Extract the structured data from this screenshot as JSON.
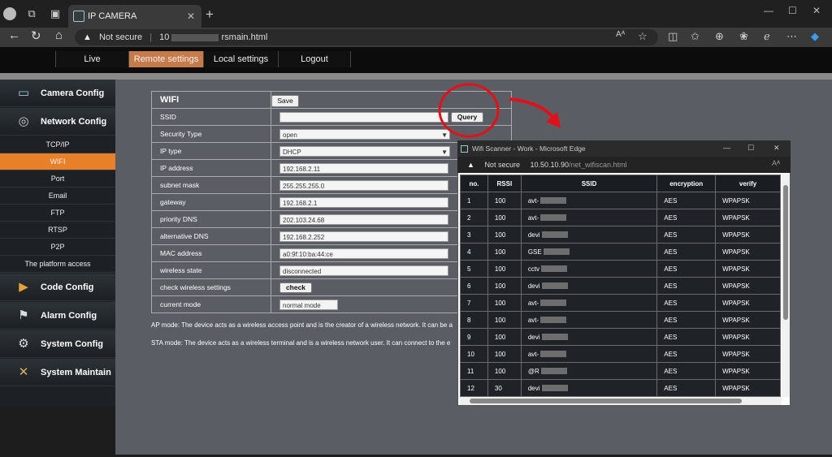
{
  "browser": {
    "tab_title": "IP CAMERA",
    "tab_close": "✕",
    "new_tab": "+",
    "security": "Not secure",
    "url_prefix": "10",
    "url_suffix": "rsmain.html",
    "read_aloud": "Aᴬ"
  },
  "topnav": {
    "tabs": [
      {
        "label": "Live"
      },
      {
        "label": "Remote settings"
      },
      {
        "label": "Local settings"
      },
      {
        "label": "Logout"
      }
    ]
  },
  "sidebar": {
    "groups": {
      "camera": "Camera Config",
      "network": "Network Config",
      "code": "Code Config",
      "alarm": "Alarm Config",
      "system": "System Config",
      "maintain": "System Maintain"
    },
    "items": [
      "TCP/IP",
      "WIFI",
      "Port",
      "Email",
      "FTP",
      "RTSP",
      "P2P",
      "The platform access"
    ]
  },
  "form": {
    "title": "WIFI",
    "save_label": "Save",
    "query_label": "Query",
    "check_label": "check",
    "rows": [
      {
        "label": "SSID",
        "value": ""
      },
      {
        "label": "Security Type",
        "value": "open"
      },
      {
        "label": "IP type",
        "value": "DHCP"
      },
      {
        "label": "IP address",
        "value": "192.168.2.11"
      },
      {
        "label": "subnet mask",
        "value": "255.255.255.0"
      },
      {
        "label": "gateway",
        "value": "192.168.2.1"
      },
      {
        "label": "priority DNS",
        "value": "202.103.24.68"
      },
      {
        "label": "alternative DNS",
        "value": "192.168.2.252"
      },
      {
        "label": "MAC address",
        "value": "a0:9f:10:ba:44:ce"
      },
      {
        "label": "wireless state",
        "value": "disconnected"
      },
      {
        "label": "check wireless settings",
        "value": ""
      },
      {
        "label": "current mode",
        "value": "normal mode"
      }
    ],
    "ap_note": "AP mode: The device acts as a wireless access point and is the creator of a wireless network. It can be a",
    "sta_note": "STA mode: The device acts as a wireless terminal and is a wireless network user. It can connect to the e"
  },
  "scanner": {
    "title": "Wifi Scanner - Work - Microsoft Edge",
    "security": "Not secure",
    "host": "10.50.10.90",
    "path": "/net_wifiscan.html",
    "columns": [
      "no.",
      "RSSI",
      "SSID",
      "encryption",
      "verify"
    ],
    "rows": [
      {
        "no": "1",
        "rssi": "100",
        "ssid": "avt-",
        "enc": "AES",
        "verify": "WPAPSK"
      },
      {
        "no": "2",
        "rssi": "100",
        "ssid": "avt-",
        "enc": "AES",
        "verify": "WPAPSK"
      },
      {
        "no": "3",
        "rssi": "100",
        "ssid": "devi",
        "enc": "AES",
        "verify": "WPAPSK"
      },
      {
        "no": "4",
        "rssi": "100",
        "ssid": "GSE",
        "enc": "AES",
        "verify": "WPAPSK"
      },
      {
        "no": "5",
        "rssi": "100",
        "ssid": "cctv",
        "enc": "AES",
        "verify": "WPAPSK"
      },
      {
        "no": "6",
        "rssi": "100",
        "ssid": "devi",
        "enc": "AES",
        "verify": "WPAPSK"
      },
      {
        "no": "7",
        "rssi": "100",
        "ssid": "avt-",
        "enc": "AES",
        "verify": "WPAPSK"
      },
      {
        "no": "8",
        "rssi": "100",
        "ssid": "avt-",
        "enc": "AES",
        "verify": "WPAPSK"
      },
      {
        "no": "9",
        "rssi": "100",
        "ssid": "devi",
        "enc": "AES",
        "verify": "WPAPSK"
      },
      {
        "no": "10",
        "rssi": "100",
        "ssid": "avt-",
        "enc": "AES",
        "verify": "WPAPSK"
      },
      {
        "no": "11",
        "rssi": "100",
        "ssid": "@R",
        "enc": "AES",
        "verify": "WPAPSK"
      },
      {
        "no": "12",
        "rssi": "30",
        "ssid": "devi",
        "enc": "AES",
        "verify": "WPAPSK"
      }
    ]
  },
  "annotation": {
    "color": "#e3101a"
  },
  "colors": {
    "accent_orange": "#e8802a",
    "active_tab": "#c77a4a"
  }
}
